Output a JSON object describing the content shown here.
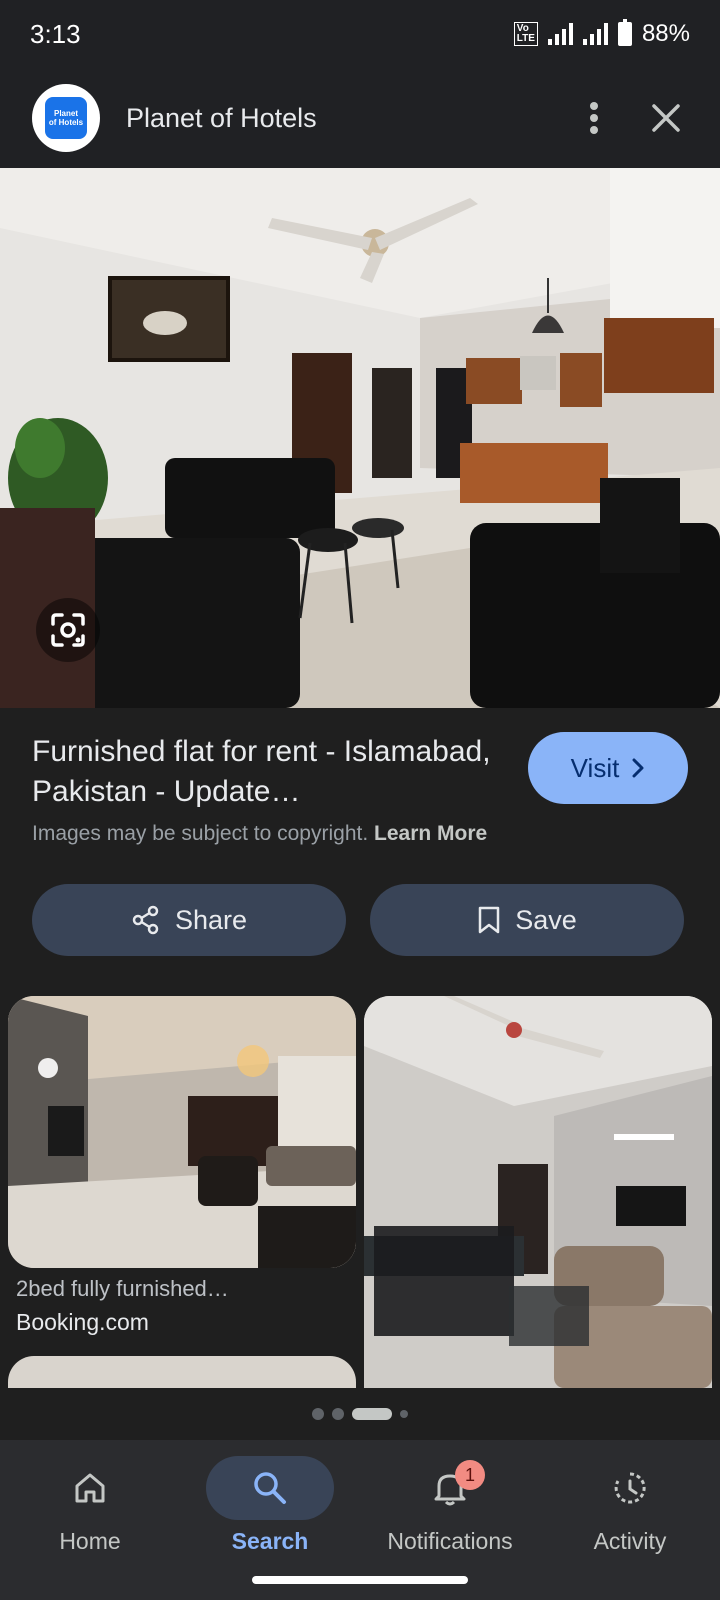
{
  "status_bar": {
    "time": "3:13",
    "network": "VoLTE 4G",
    "battery": "88%"
  },
  "header": {
    "logo_text_line1": "Planet",
    "logo_text_line2": "of Hotels",
    "site_name": "Planet of Hotels"
  },
  "result": {
    "title": "Furnished flat for rent - Islamabad, Pakistan - Update…",
    "visit_label": "Visit",
    "copyright_text": "Images may be subject to copyright.",
    "learn_more": "Learn More",
    "share_label": "Share",
    "save_label": "Save"
  },
  "related": [
    {
      "caption": "2bed fully furnished…",
      "source": "Booking.com"
    }
  ],
  "pager": {
    "count": 4,
    "active_index": 2
  },
  "nav": {
    "home": "Home",
    "search": "Search",
    "notifications": "Notifications",
    "notifications_badge": "1",
    "activity": "Activity"
  },
  "colors": {
    "accent": "#8ab4f8",
    "button_bg": "#394457",
    "badge": "#f28b82",
    "background": "#1f1f1f"
  }
}
